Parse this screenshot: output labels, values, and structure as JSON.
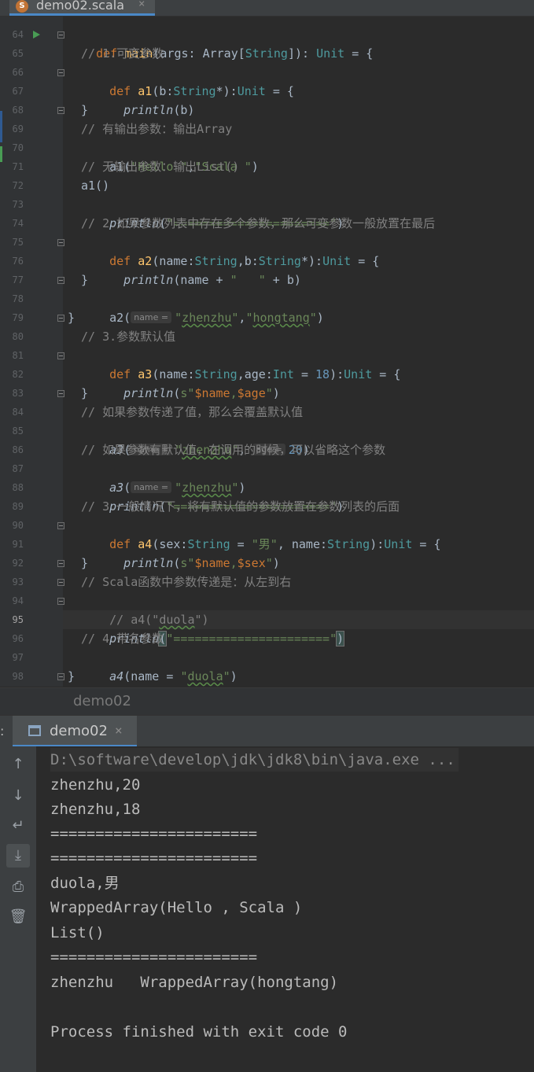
{
  "editor_tab": {
    "file_name": "demo02.scala",
    "close_glyph": "×"
  },
  "current_line_number": "95",
  "line_numbers": [
    "64",
    "65",
    "66",
    "67",
    "68",
    "69",
    "70",
    "71",
    "72",
    "73",
    "74",
    "75",
    "76",
    "77",
    "78",
    "79",
    "80",
    "81",
    "82",
    "83",
    "84",
    "85",
    "86",
    "87",
    "88",
    "89",
    "90",
    "91",
    "92",
    "93",
    "94",
    "95",
    "96",
    "97",
    "98"
  ],
  "code": {
    "l64": [
      "def ",
      "main",
      "(args: Array[",
      "String",
      "]): ",
      "Unit",
      " = {"
    ],
    "l65": "// 1.可变参数",
    "l66": [
      "def ",
      "a1",
      "(b:",
      "String",
      "*):",
      "Unit",
      " = {"
    ],
    "l67": [
      "println",
      "(b)"
    ],
    "l68": "}",
    "l69": "// 有输出参数：输出Array",
    "l70": [
      "a1(",
      "\"Hello \"",
      ",",
      "\"Scala \"",
      ")"
    ],
    "l71": "// 无输出参数：输出List()",
    "l72": "a1()",
    "l73": [
      "println",
      "(",
      "\"======================\"",
      ")"
    ],
    "l74": "// 2.如果参数列表中存在多个参数，那么可变参数一般放置在最后",
    "l75": [
      "def ",
      "a2",
      "(name:",
      "String",
      ",b:",
      "String",
      "*):",
      "Unit",
      " = {"
    ],
    "l76": [
      "println",
      "(name + ",
      "\"   \"",
      " + b)"
    ],
    "l77": "}",
    "l78": [
      "a2(",
      "name =",
      "\"",
      "zhenzhu",
      "\"",
      ",",
      "\"",
      "hongtang",
      "\"",
      ")"
    ],
    "l79": "}",
    "l80": "// 3.参数默认值",
    "l81": [
      "def ",
      "a3",
      "(name:",
      "String",
      ",age:",
      "Int",
      " = ",
      "18",
      "):",
      "Unit",
      " = {"
    ],
    "l82": [
      "println",
      "(",
      "s\"",
      "$name",
      ",",
      "$age",
      "\"",
      ")"
    ],
    "l83": "}",
    "l84": "// 如果参数传递了值，那么会覆盖默认值",
    "l85": [
      "a3",
      "(",
      "name =",
      "\"",
      "zhenzhu",
      "\"",
      ", ",
      "age =",
      "20",
      ")"
    ],
    "l86": "// 如果参数有默认值，在调用的时候，可以省略这个参数",
    "l87": [
      "a3",
      "(",
      "name =",
      "\"",
      "zhenzhu",
      "\"",
      ")"
    ],
    "l88": [
      "println",
      "(",
      "\"======================\"",
      ")"
    ],
    "l89": "// 3.一般情况下，将有默认值的参数放置在参数列表的后面",
    "l90": [
      "def ",
      "a4",
      "(sex:",
      "String",
      " = ",
      "\"男\"",
      ", name:",
      "String",
      "):",
      "Unit",
      " = {"
    ],
    "l91": [
      "println",
      "(",
      "s\"",
      "$name",
      ",",
      "$sex",
      "\"",
      ")"
    ],
    "l92": "}",
    "l93": "// Scala函数中参数传递是：从左到右",
    "l94": [
      "// a4(\"",
      "duola",
      "\")"
    ],
    "l95": [
      "println",
      "(",
      "\"======================\"",
      ")"
    ],
    "l96": "// 4.带名参数",
    "l97": [
      "a4",
      "(name = ",
      "\"",
      "duola",
      "\"",
      ")"
    ],
    "l98": "}"
  },
  "breadcrumb": "demo02",
  "run_window": {
    "colon": ":",
    "tab_label": "demo02",
    "close_glyph": "×",
    "toolbar_icons": [
      "arrow-up-icon",
      "arrow-down-icon",
      "soft-wrap-icon",
      "scroll-to-end-icon",
      "print-icon",
      "trash-icon"
    ],
    "toolbar_glyphs": [
      "↑",
      "↓",
      "↵",
      "⤓",
      "⎙",
      "🗑"
    ],
    "console_lines": [
      "D:\\software\\develop\\jdk\\jdk8\\bin\\java.exe ...",
      "zhenzhu,20",
      "zhenzhu,18",
      "=======================",
      "=======================",
      "duola,男",
      "WrappedArray(Hello , Scala )",
      "List()",
      "=======================",
      "zhenzhu   WrappedArray(hongtang)",
      "",
      "Process finished with exit code 0"
    ]
  },
  "colors": {
    "editor_bg": "#2b2b2b",
    "gutter_bg": "#313335",
    "keyword": "#cc7832",
    "function": "#ffc66d",
    "string": "#6a8759",
    "number": "#6897bb",
    "comment": "#808080",
    "accent": "#4a88c7"
  }
}
